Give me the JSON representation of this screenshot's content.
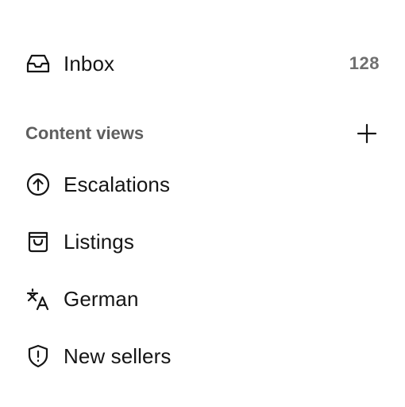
{
  "inbox": {
    "label": "Inbox",
    "count": "128",
    "icon": "inbox-tray-icon"
  },
  "content_views": {
    "title": "Content views",
    "add_icon": "plus-icon",
    "items": [
      {
        "label": "Escalations",
        "icon": "arrow-up-circle-icon"
      },
      {
        "label": "Listings",
        "icon": "shopping-bag-icon"
      },
      {
        "label": "German",
        "icon": "translate-icon"
      },
      {
        "label": "New sellers",
        "icon": "shield-alert-icon"
      }
    ]
  },
  "colors": {
    "text": "#151515",
    "muted": "#6f6f6f",
    "section_title": "#5f5f5f",
    "background": "#ffffff"
  }
}
